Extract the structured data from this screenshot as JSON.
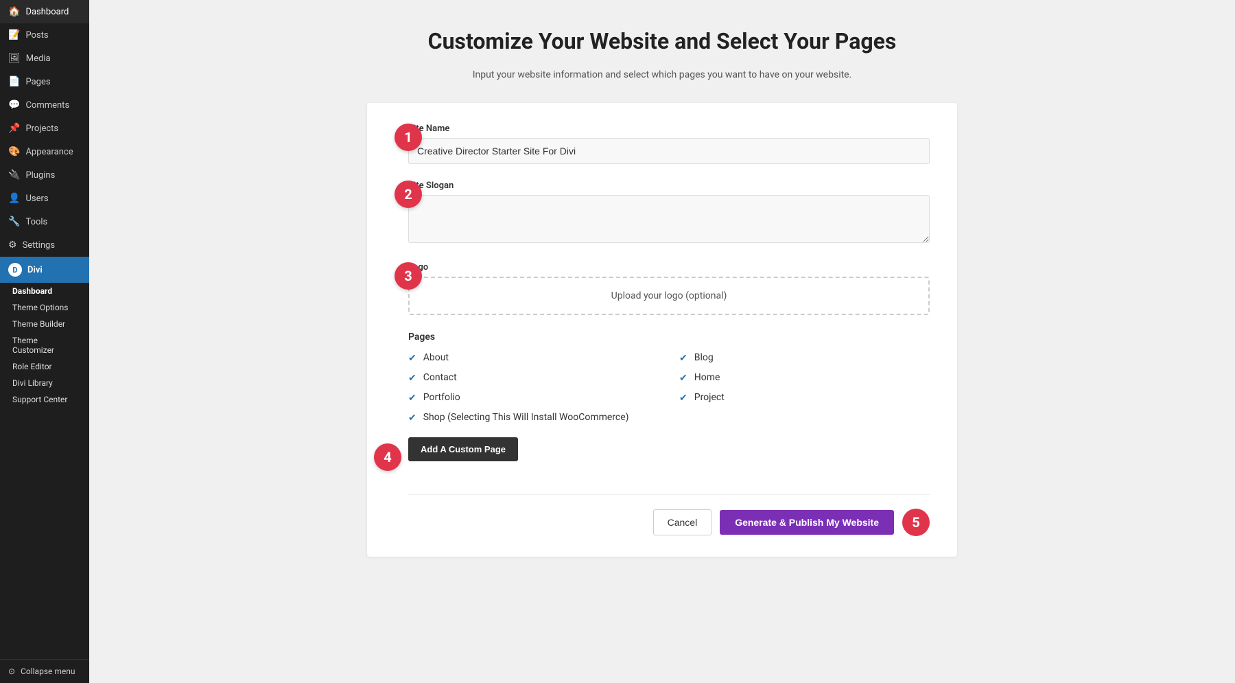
{
  "sidebar": {
    "items": [
      {
        "id": "dashboard",
        "label": "Dashboard",
        "icon": "🏠"
      },
      {
        "id": "posts",
        "label": "Posts",
        "icon": "📝"
      },
      {
        "id": "media",
        "label": "Media",
        "icon": "🖼"
      },
      {
        "id": "pages",
        "label": "Pages",
        "icon": "📄"
      },
      {
        "id": "comments",
        "label": "Comments",
        "icon": "💬"
      },
      {
        "id": "projects",
        "label": "Projects",
        "icon": "📌"
      },
      {
        "id": "appearance",
        "label": "Appearance",
        "icon": "🎨"
      },
      {
        "id": "plugins",
        "label": "Plugins",
        "icon": "🔌"
      },
      {
        "id": "users",
        "label": "Users",
        "icon": "👤"
      },
      {
        "id": "tools",
        "label": "Tools",
        "icon": "🔧"
      },
      {
        "id": "settings",
        "label": "Settings",
        "icon": "⚙"
      }
    ],
    "divi": {
      "label": "Divi",
      "icon": "D",
      "subitems": [
        {
          "id": "dashboard",
          "label": "Dashboard",
          "bold": true
        },
        {
          "id": "theme-options",
          "label": "Theme Options"
        },
        {
          "id": "theme-builder",
          "label": "Theme Builder"
        },
        {
          "id": "theme-customizer",
          "label": "Theme Customizer"
        },
        {
          "id": "role-editor",
          "label": "Role Editor"
        },
        {
          "id": "divi-library",
          "label": "Divi Library"
        },
        {
          "id": "support-center",
          "label": "Support Center"
        }
      ]
    },
    "collapse_label": "Collapse menu"
  },
  "page": {
    "title": "Customize Your Website and Select Your Pages",
    "subtitle": "Input your website information and select which pages you want to have on your website."
  },
  "form": {
    "site_name_label": "Site Name",
    "site_name_value": "Creative Director Starter Site For Divi",
    "site_name_placeholder": "Creative Director Starter Site For Divi",
    "site_slogan_label": "Site Slogan",
    "site_slogan_value": "",
    "site_slogan_placeholder": "",
    "logo_label": "Logo",
    "logo_upload_text": "Upload your logo (optional)",
    "pages_label": "Pages",
    "pages": [
      {
        "id": "about",
        "label": "About",
        "checked": true
      },
      {
        "id": "blog",
        "label": "Blog",
        "checked": true
      },
      {
        "id": "contact",
        "label": "Contact",
        "checked": true
      },
      {
        "id": "home",
        "label": "Home",
        "checked": true
      },
      {
        "id": "portfolio",
        "label": "Portfolio",
        "checked": true
      },
      {
        "id": "project",
        "label": "Project",
        "checked": true
      },
      {
        "id": "shop",
        "label": "Shop (Selecting This Will Install WooCommerce)",
        "checked": true
      }
    ],
    "add_custom_page_label": "Add A Custom Page",
    "cancel_label": "Cancel",
    "publish_label": "Generate & Publish My Website"
  },
  "steps": {
    "step1": "1",
    "step2": "2",
    "step3": "3",
    "step4": "4",
    "step5": "5"
  }
}
